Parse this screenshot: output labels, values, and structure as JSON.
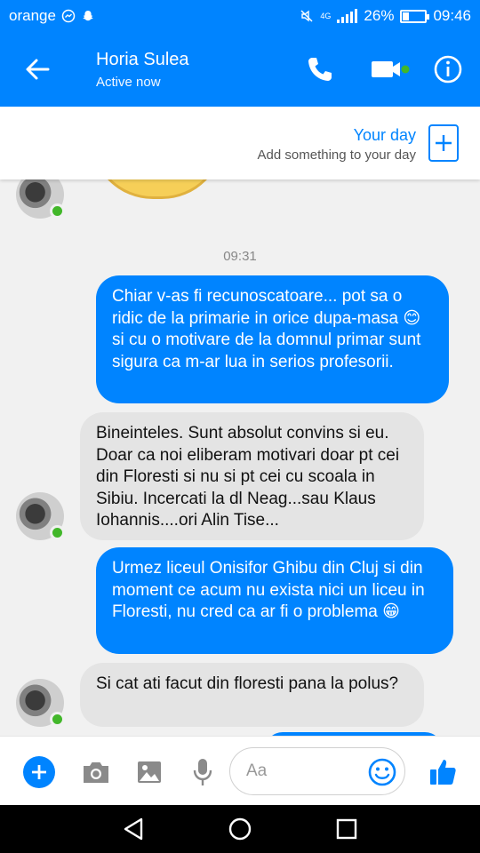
{
  "status_bar": {
    "carrier": "orange",
    "network": "4G",
    "battery": "26%",
    "time": "09:46",
    "battery_level": 0.26
  },
  "header": {
    "name": "Horia Sulea",
    "status": "Active now",
    "icons": [
      "back-arrow-icon",
      "phone-icon",
      "video-camera-icon",
      "info-icon"
    ]
  },
  "your_day": {
    "title": "Your day",
    "subtitle": "Add something to your day"
  },
  "chat": {
    "timestamp": "09:31",
    "messages": [
      {
        "from": "me",
        "text": "Chiar v-as fi recunoscatoare... pot sa o ridic de la primarie in orice dupa-masa 😊 si cu o motivare de la domnul primar sunt sigura ca m-ar lua in serios profesorii."
      },
      {
        "from": "contact",
        "text": "Bineinteles. Sunt absolut convins si eu. Doar ca noi eliberam motivari doar pt cei din Floresti si nu si pt cei cu scoala in Sibiu. Incercati la dl Neag...sau Klaus Iohannis....ori Alin Tise..."
      },
      {
        "from": "me",
        "text": "Urmez liceul Onisifor Ghibu din Cluj si din moment ce acum nu exista nici un liceu in Floresti, nu cred ca ar fi o problema 😁"
      },
      {
        "from": "contact",
        "text": "Si cat ati facut din floresti pana la polus?"
      }
    ]
  },
  "composer": {
    "placeholder": "Aa",
    "icons": [
      "plus-icon",
      "camera-icon",
      "gallery-icon",
      "microphone-icon",
      "emoji-icon",
      "thumbs-up-icon"
    ]
  },
  "colors": {
    "accent": "#0084ff",
    "incoming_bubble": "#e4e4e4",
    "online": "#42b72a"
  }
}
